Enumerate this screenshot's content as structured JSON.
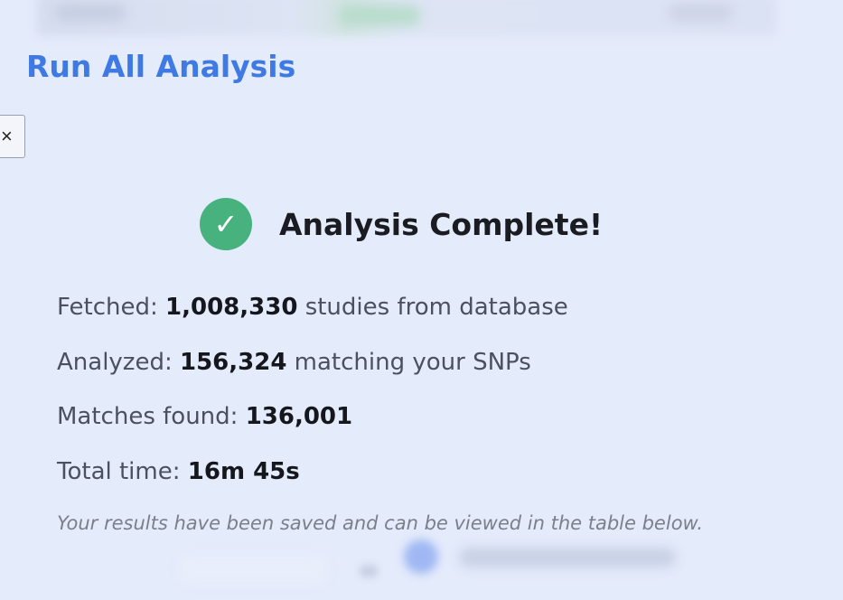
{
  "modal": {
    "title": "Run All Analysis",
    "close_label": "×"
  },
  "result": {
    "icon": "check-icon",
    "icon_glyph": "✓",
    "icon_color": "#47b27e",
    "title": "Analysis Complete!",
    "stats": {
      "fetched": {
        "label": "Fetched:",
        "value": "1,008,330",
        "suffix": "studies from database"
      },
      "analyzed": {
        "label": "Analyzed:",
        "value": "156,324",
        "suffix": "matching your SNPs"
      },
      "matches": {
        "label": "Matches found:",
        "value": "136,001"
      },
      "total_time": {
        "label": "Total time:",
        "value": "16m 45s"
      }
    },
    "note": "Your results have been saved and can be viewed in the table below."
  },
  "colors": {
    "accent": "#3f7ae4",
    "background": "#e4ebfb",
    "success": "#47b27e"
  }
}
